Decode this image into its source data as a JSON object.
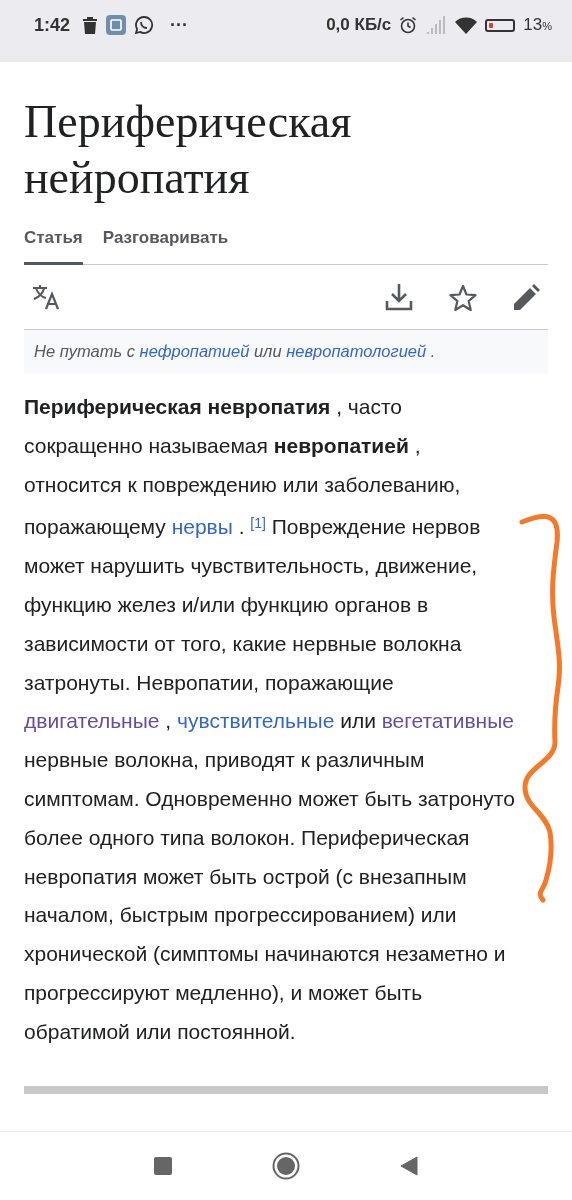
{
  "status_bar": {
    "time": "1:42",
    "more": "···",
    "speed": "0,0 КБ/с",
    "battery": "13",
    "battery_unit": "%"
  },
  "article": {
    "title": "Периферическая нейропатия",
    "tabs": [
      {
        "label": "Статья",
        "selected": true
      },
      {
        "label": "Разговаривать",
        "selected": false
      }
    ],
    "hatnote": [
      {
        "kind": "plain",
        "text": "Не путать с "
      },
      {
        "kind": "link",
        "text": "нефропатией",
        "visited": false
      },
      {
        "kind": "plain",
        "text": " или "
      },
      {
        "kind": "link",
        "text": "невропатологией",
        "visited": false
      },
      {
        "kind": "plain",
        "text": " ."
      }
    ],
    "paragraph": [
      {
        "kind": "bold",
        "text": "Периферическая невропатия"
      },
      {
        "kind": "plain",
        "text": " , часто сокращенно называемая "
      },
      {
        "kind": "bold",
        "text": "невропатией"
      },
      {
        "kind": "plain",
        "text": " , относится к повреждению или заболеванию, поражающему "
      },
      {
        "kind": "link",
        "text": "нервы",
        "visited": false
      },
      {
        "kind": "plain",
        "text": " . "
      },
      {
        "kind": "ref",
        "text": "[1]"
      },
      {
        "kind": "plain",
        "text": " Повреждение нервов может нарушить чувствительность, движение, функцию желез и/или функцию органов в зависимости от того, какие нервные волокна затронуты. Невропатии, поражающие "
      },
      {
        "kind": "link",
        "text": "двигательные",
        "visited": true
      },
      {
        "kind": "plain",
        "text": " , "
      },
      {
        "kind": "link",
        "text": "чувствительные",
        "visited": false
      },
      {
        "kind": "plain",
        "text": " или "
      },
      {
        "kind": "link",
        "text": "вегетативные",
        "visited": true
      },
      {
        "kind": "plain",
        "text": " нервные волокна, приводят к различным симптомам. Одновременно может быть затронуто более одного типа волокон. Периферическая невропатия может быть острой (с внезапным началом, быстрым прогрессированием) или хронической (симптомы начинаются незаметно и прогрессируют медленно), и может быть обратимой или постоянной."
      }
    ]
  }
}
